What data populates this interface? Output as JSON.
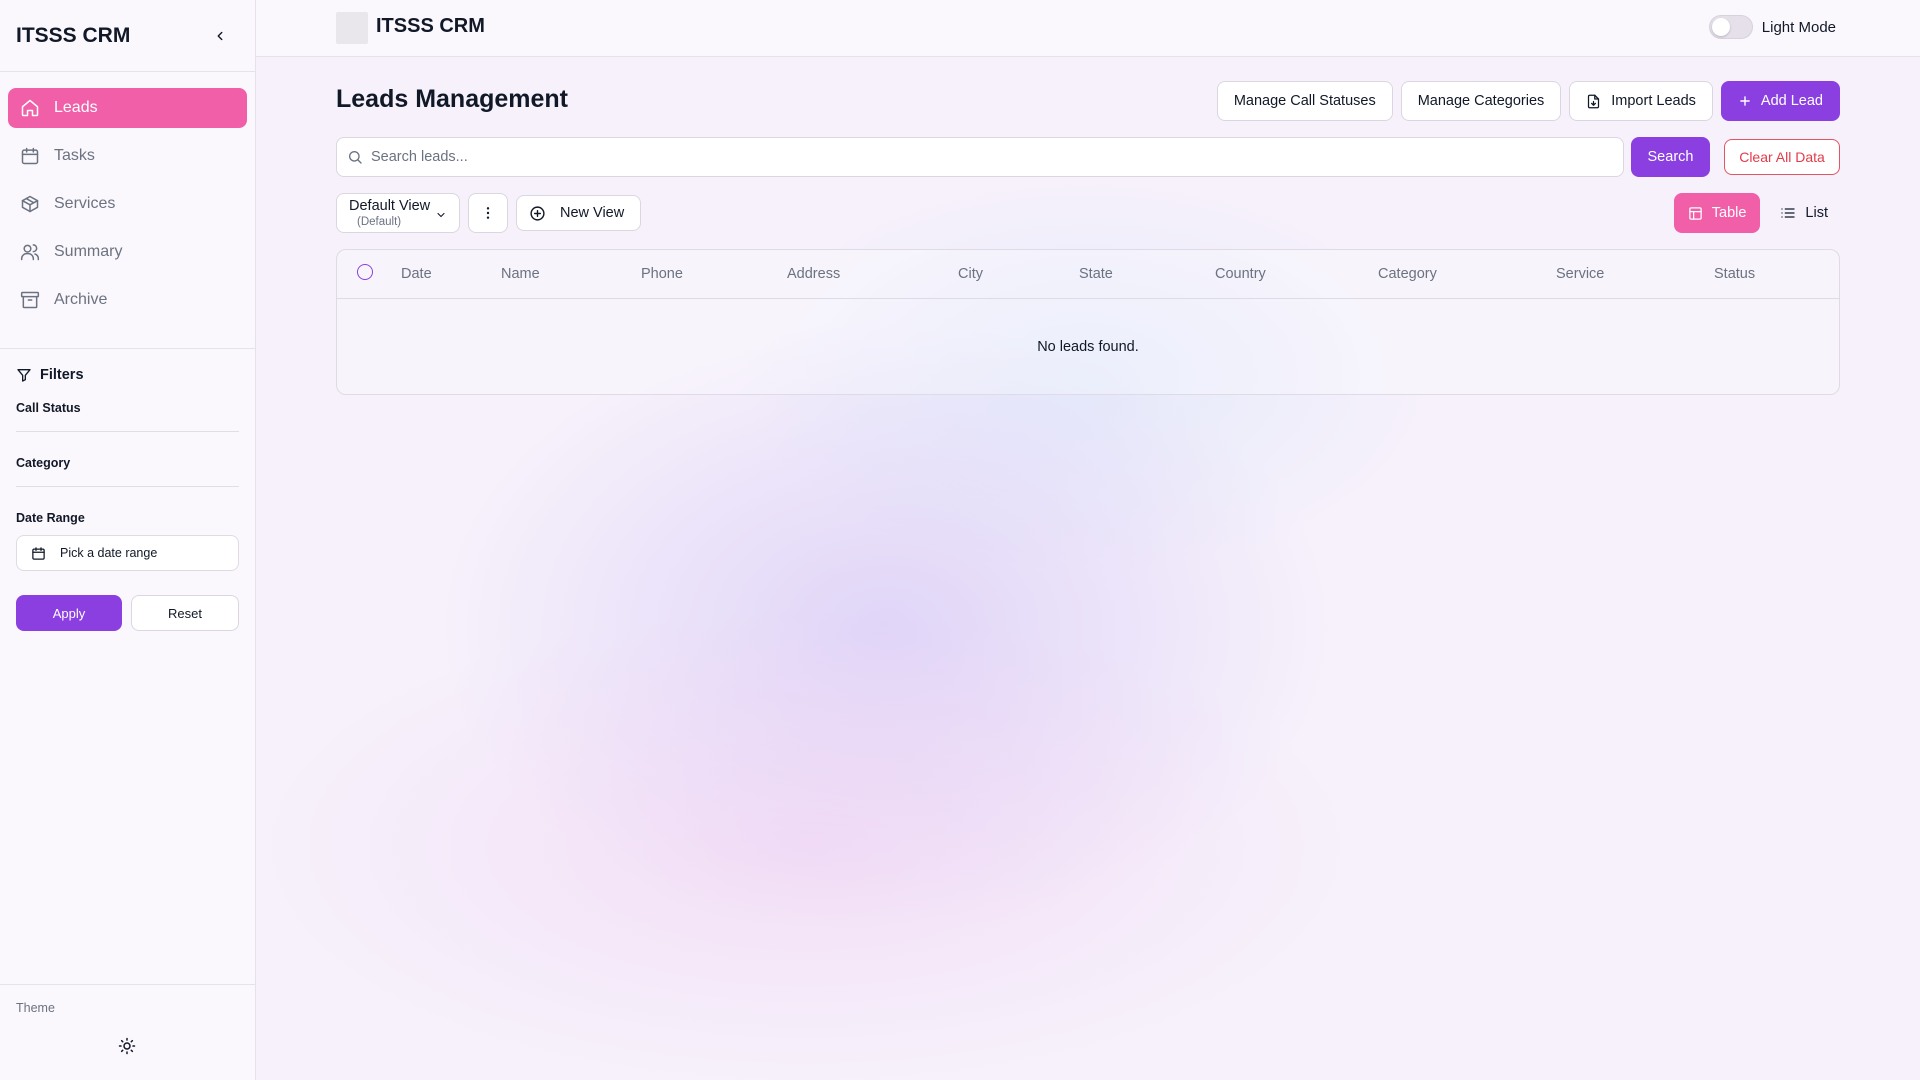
{
  "app": {
    "title": "ITSSS CRM"
  },
  "sidebar": {
    "brand": "ITSSS CRM",
    "items": [
      {
        "label": "Leads",
        "icon": "home-icon",
        "active": true
      },
      {
        "label": "Tasks",
        "icon": "calendar-icon"
      },
      {
        "label": "Services",
        "icon": "package-icon"
      },
      {
        "label": "Summary",
        "icon": "users-icon"
      },
      {
        "label": "Archive",
        "icon": "archive-icon"
      }
    ],
    "filters": {
      "title": "Filters",
      "call_status_label": "Call Status",
      "category_label": "Category",
      "date_range_label": "Date Range",
      "date_placeholder": "Pick a date range",
      "apply_label": "Apply",
      "reset_label": "Reset"
    },
    "footer": {
      "theme_label": "Theme",
      "theme_icon": "sun-icon"
    }
  },
  "topbar": {
    "title": "ITSSS CRM",
    "mode_label": "Light Mode",
    "mode_on": false
  },
  "main": {
    "page_title": "Leads Management",
    "actions": {
      "manage_call_statuses": "Manage Call Statuses",
      "manage_categories": "Manage Categories",
      "import_leads": "Import Leads",
      "add_lead": "Add Lead"
    },
    "search": {
      "placeholder": "Search leads...",
      "value": "",
      "button": "Search",
      "clear_all": "Clear All Data"
    },
    "view": {
      "name": "Default View",
      "sub": "(Default)",
      "new_view": "New View",
      "table_label": "Table",
      "list_label": "List",
      "mode": "table"
    },
    "table": {
      "columns": [
        "Date",
        "Name",
        "Phone",
        "Address",
        "City",
        "State",
        "Country",
        "Category",
        "Service",
        "Status"
      ],
      "rows": [],
      "empty_text": "No leads found."
    }
  },
  "colors": {
    "accent": "#8b3fe0",
    "pink": "#f05fa8",
    "danger": "#e23b4a"
  }
}
